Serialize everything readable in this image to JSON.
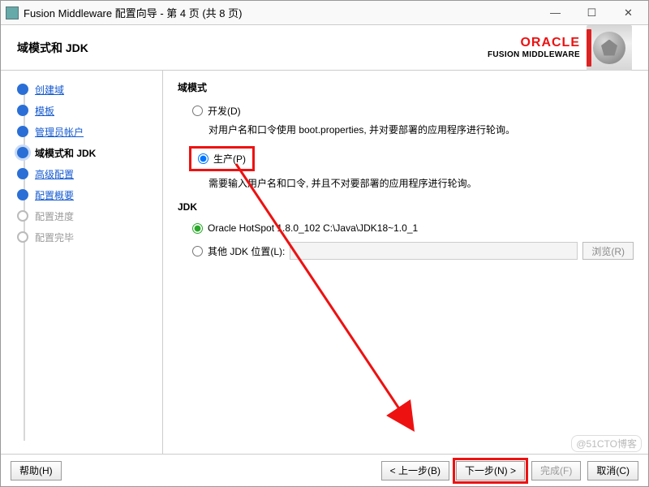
{
  "window": {
    "title": "Fusion Middleware 配置向导 - 第 4 页 (共 8 页)"
  },
  "header": {
    "title": "域模式和 JDK",
    "brand": "ORACLE",
    "subbrand": "FUSION MIDDLEWARE"
  },
  "sidebar": {
    "items": [
      {
        "label": "创建域",
        "state": "done"
      },
      {
        "label": "模板",
        "state": "done"
      },
      {
        "label": "管理员帐户",
        "state": "done"
      },
      {
        "label": "域模式和 JDK",
        "state": "current"
      },
      {
        "label": "高级配置",
        "state": "done"
      },
      {
        "label": "配置概要",
        "state": "done"
      },
      {
        "label": "配置进度",
        "state": "pending"
      },
      {
        "label": "配置完毕",
        "state": "pending"
      }
    ]
  },
  "main": {
    "domain_mode_title": "域模式",
    "dev_label": "开发(D)",
    "dev_desc": "对用户名和口令使用 boot.properties, 并对要部署的应用程序进行轮询。",
    "prod_label": "生产(P)",
    "prod_desc": "需要输入用户名和口令, 并且不对要部署的应用程序进行轮询。",
    "jdk_title": "JDK",
    "jdk_oracle_label": "Oracle HotSpot 1.8.0_102 C:\\Java\\JDK18~1.0_1",
    "jdk_other_label": "其他 JDK 位置(L):",
    "jdk_other_value": "",
    "browse_label": "浏览(R)"
  },
  "footer": {
    "help": "帮助(H)",
    "back": "< 上一步(B)",
    "next": "下一步(N) >",
    "finish": "完成(F)",
    "cancel": "取消(C)"
  },
  "watermark": "@51CTO博客"
}
